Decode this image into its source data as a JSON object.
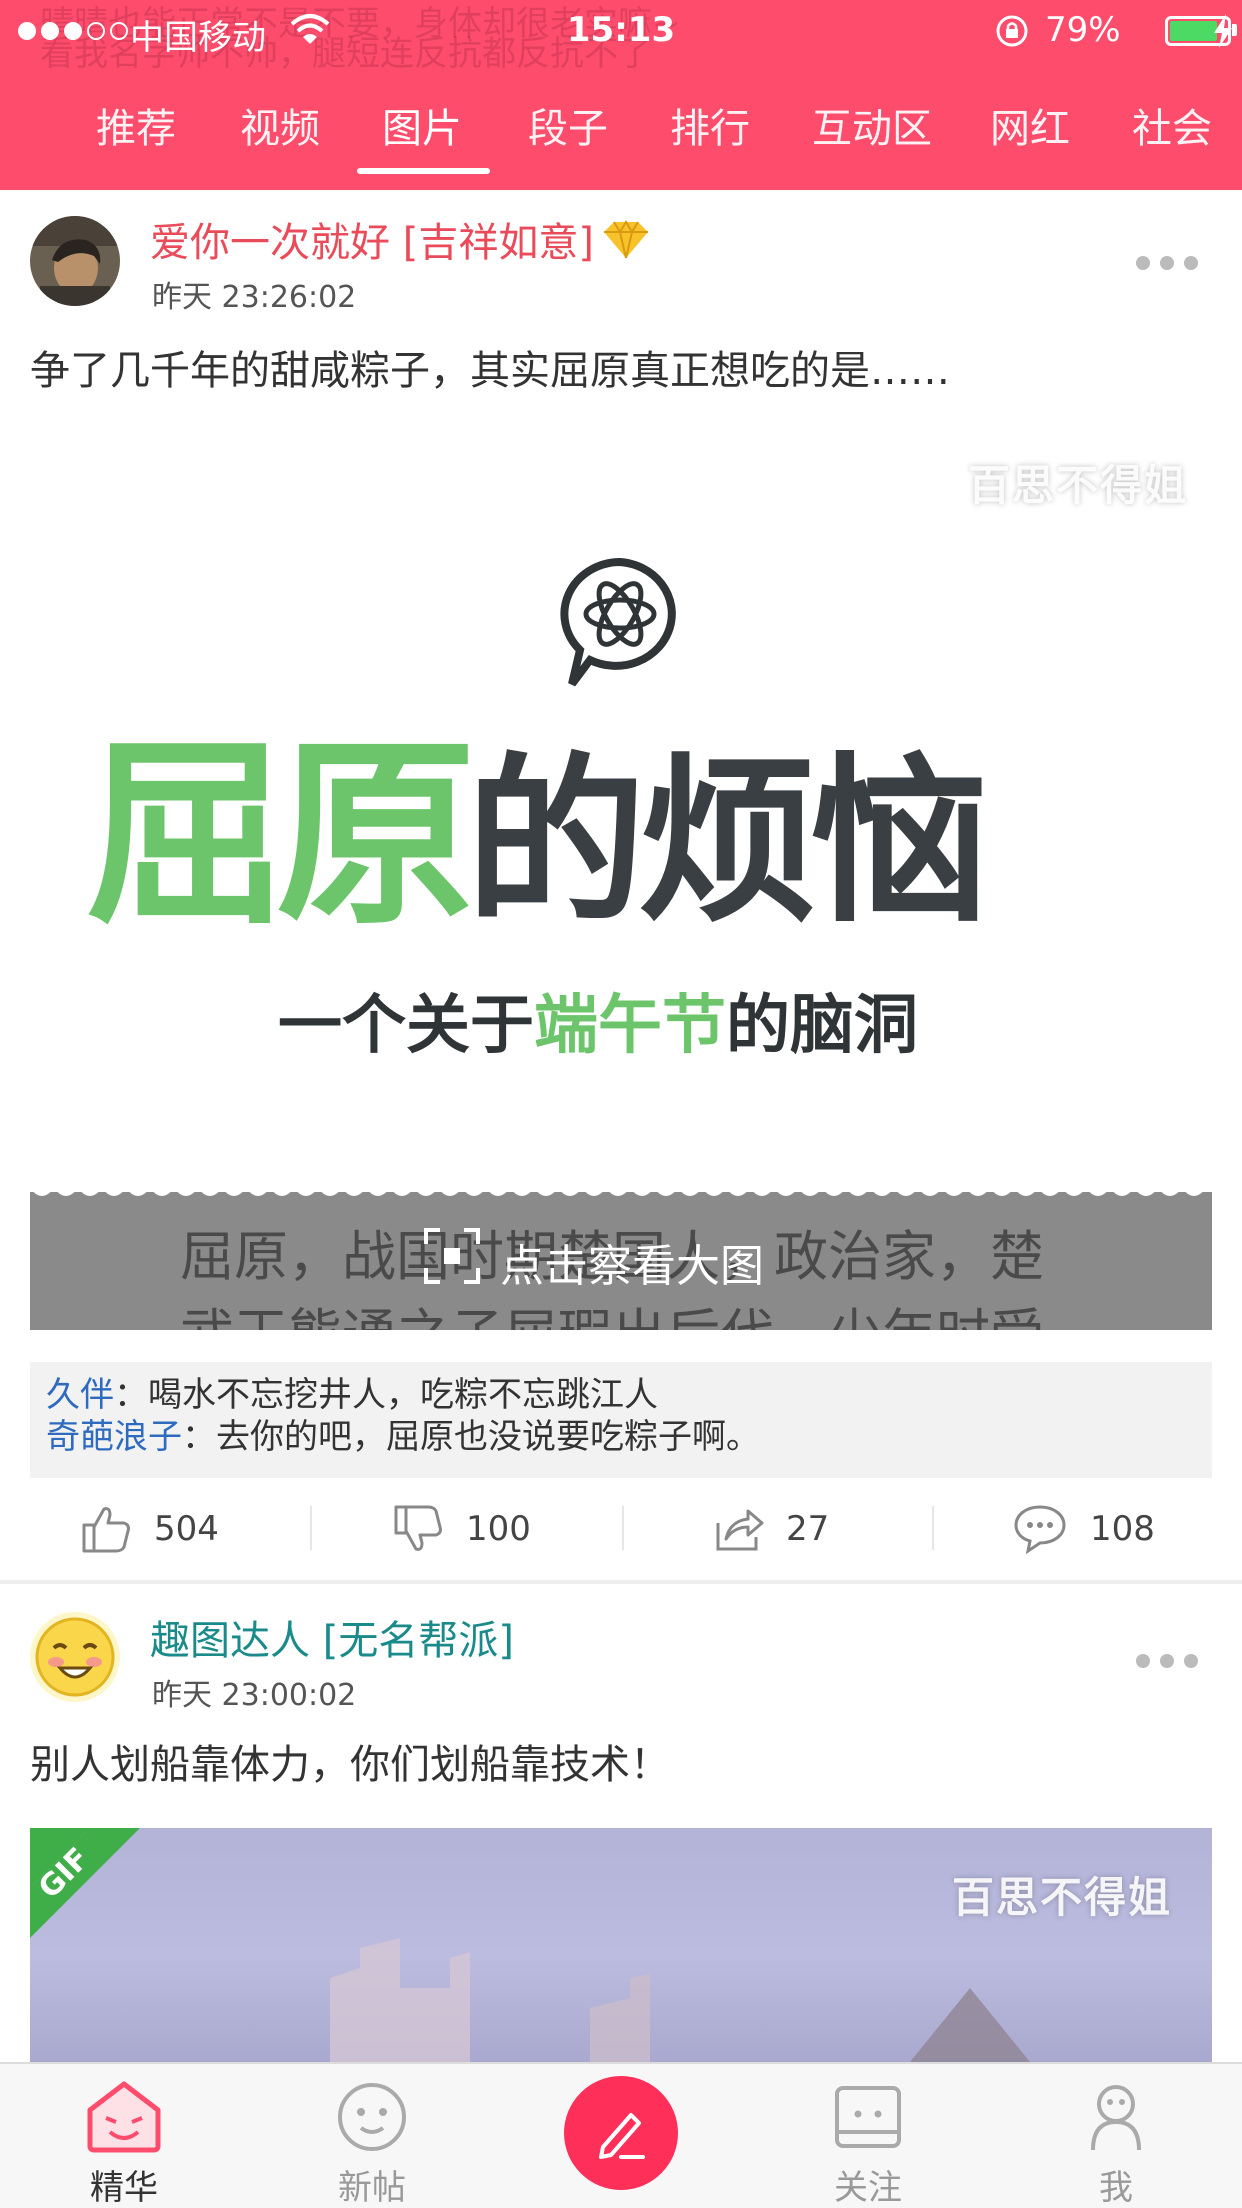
{
  "status": {
    "carrier": "中国移动",
    "time": "15:13",
    "battery": "79%",
    "battery_level": 0.79
  },
  "ghost_text": {
    "line1": "晴晴也能正常不是不要，身体却很老实嘛~",
    "line2": "看我名字帅不帅，腿短连反抗都反抗不了"
  },
  "tabs": [
    "推荐",
    "视频",
    "图片",
    "段子",
    "排行",
    "互动区",
    "网红",
    "社会"
  ],
  "active_tab": "图片",
  "posts": [
    {
      "username": "爱你一次就好 [吉祥如意]",
      "time": "昨天 23:26:02",
      "text": "争了几千年的甜咸粽子，其实屈原真正想吃的是……",
      "image": {
        "watermark": "百思不得姐",
        "title_part1": "屈原",
        "title_part2": "的烦恼",
        "subtitle_a": "一个关于",
        "subtitle_b": "端午节",
        "subtitle_c": "的脑洞",
        "preview_text_1": "屈原，战国时期楚国人，政治家，楚",
        "preview_text_2": "武王熊通之子屈瑕出后代，少年时受",
        "view_large": "点击察看大图"
      },
      "comments": [
        {
          "user": "久伴",
          "text": "：喝水不忘挖井人，吃粽不忘跳江人"
        },
        {
          "user": "奇葩浪子",
          "text": "：去你的吧，屈原也没说要吃粽子啊。"
        }
      ],
      "likes": "504",
      "dislikes": "100",
      "shares": "27",
      "comment_count": "108"
    },
    {
      "username": "趣图达人 [无名帮派]",
      "time": "昨天 23:00:02",
      "text": "别人划船靠体力，你们划船靠技术！",
      "image": {
        "watermark": "百思不得姐",
        "badge": "GIF"
      }
    }
  ],
  "bottom_nav": {
    "featured": "精华",
    "new_posts": "新帖",
    "follow": "关注",
    "me": "我"
  },
  "colors": {
    "brand": "#fe4d6c",
    "username_red": "#e94b5a",
    "username_teal": "#1a8a8a",
    "link_blue": "#2e6bbf",
    "title_green": "#6cc56a",
    "title_dark": "#3a3f44"
  }
}
